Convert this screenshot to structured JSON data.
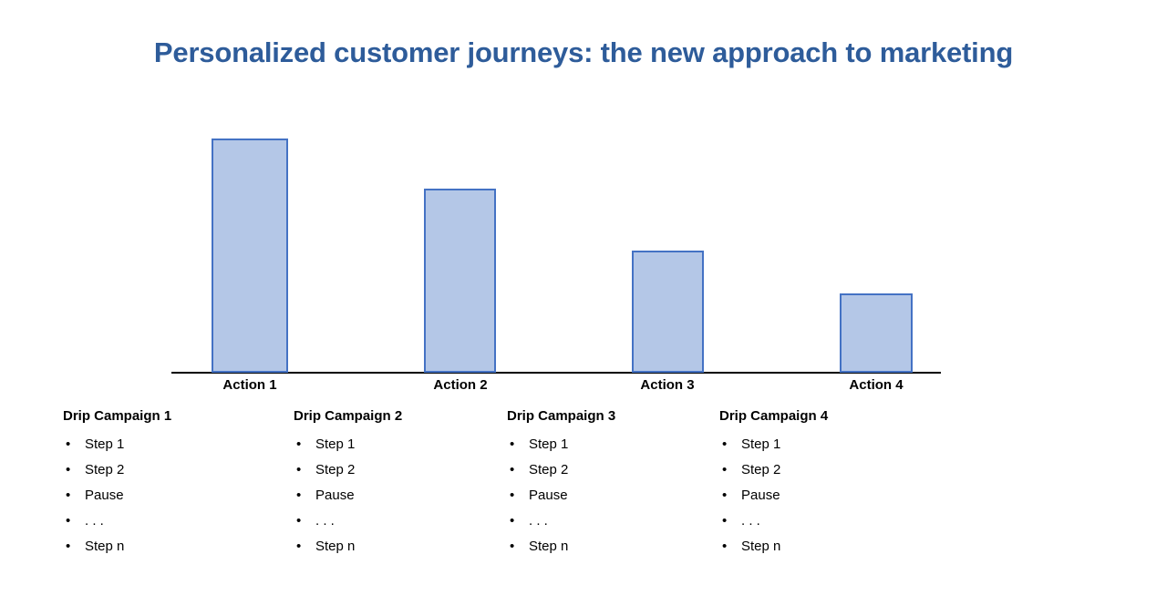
{
  "slide": {
    "title": "Personalized customer journeys: the new approach to marketing",
    "background_color": "#FFFFFF",
    "title_color": "#2E5C9A"
  },
  "chart_data": {
    "type": "bar",
    "title": "",
    "xlabel": "",
    "ylabel": "",
    "categories": [
      "Action 1",
      "Action 2",
      "Action 3",
      "Action 4"
    ],
    "values": [
      100,
      78.6,
      52.1,
      33.9
    ],
    "ylim": [
      0,
      100
    ],
    "grid": false,
    "legend": null,
    "bar_fill_color": "#B4C7E7",
    "bar_border_color": "#4472C4",
    "axis_line_color": "#000000",
    "tick_labels": [
      "Action 1",
      "Action 2",
      "Action 3",
      "Action 4"
    ]
  },
  "campaigns": [
    {
      "title": "Drip Campaign 1",
      "steps": [
        "Step 1",
        "Step 2",
        "Pause",
        ". . .",
        "Step n"
      ]
    },
    {
      "title": "Drip Campaign 2",
      "steps": [
        "Step 1",
        "Step 2",
        "Pause",
        ". . .",
        "Step n"
      ]
    },
    {
      "title": "Drip Campaign 3",
      "steps": [
        "Step 1",
        "Step 2",
        "Pause",
        ". . .",
        "Step n"
      ]
    },
    {
      "title": "Drip Campaign 4",
      "steps": [
        "Step 1",
        "Step 2",
        "Pause",
        ". . .",
        "Step n"
      ]
    }
  ],
  "bullet_glyph": "•"
}
